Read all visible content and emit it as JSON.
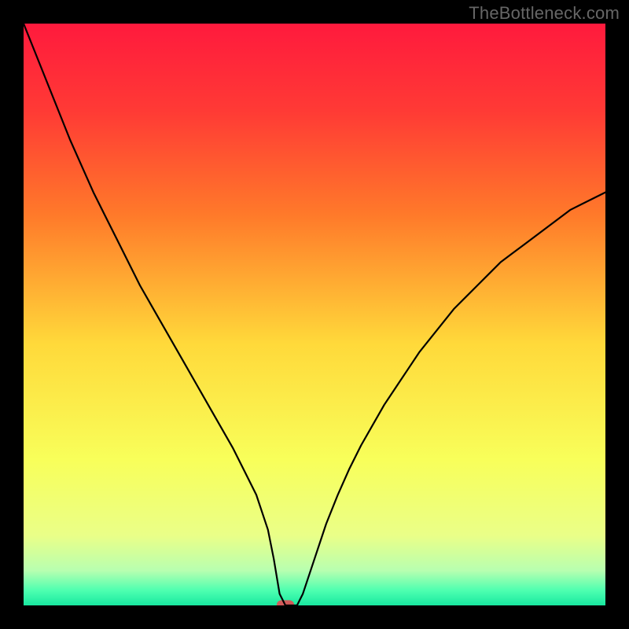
{
  "watermark": "TheBottleneck.com",
  "chart_data": {
    "type": "line",
    "title": "",
    "xlabel": "",
    "ylabel": "",
    "xlim": [
      0,
      100
    ],
    "ylim": [
      0,
      100
    ],
    "x": [
      0,
      2,
      4,
      6,
      8,
      10,
      12,
      14,
      16,
      18,
      20,
      22,
      24,
      26,
      28,
      30,
      32,
      34,
      36,
      38,
      40,
      42,
      43,
      44,
      45,
      46,
      47,
      48,
      50,
      52,
      54,
      56,
      58,
      60,
      62,
      64,
      66,
      68,
      70,
      72,
      74,
      76,
      78,
      80,
      82,
      84,
      86,
      88,
      90,
      92,
      94,
      96,
      98,
      100
    ],
    "values": [
      100,
      95,
      90,
      85,
      80,
      75.5,
      71,
      67,
      63,
      59,
      55,
      51.5,
      48,
      44.5,
      41,
      37.5,
      34,
      30.5,
      27,
      23,
      19,
      13,
      8,
      2,
      0,
      0,
      0,
      2,
      8,
      14,
      19,
      23.5,
      27.5,
      31,
      34.5,
      37.5,
      40.5,
      43.5,
      46,
      48.5,
      51,
      53,
      55,
      57,
      59,
      60.5,
      62,
      63.5,
      65,
      66.5,
      68,
      69,
      70,
      71
    ],
    "background_gradient": {
      "stops": [
        {
          "pos": 0.0,
          "color": "#ff1a3d"
        },
        {
          "pos": 0.15,
          "color": "#ff3a35"
        },
        {
          "pos": 0.33,
          "color": "#ff7a2a"
        },
        {
          "pos": 0.55,
          "color": "#ffd93a"
        },
        {
          "pos": 0.75,
          "color": "#f8ff5a"
        },
        {
          "pos": 0.88,
          "color": "#eaff88"
        },
        {
          "pos": 0.94,
          "color": "#b8ffb0"
        },
        {
          "pos": 0.975,
          "color": "#4cffb0"
        },
        {
          "pos": 1.0,
          "color": "#18e8a0"
        }
      ]
    },
    "marker": {
      "x": 45,
      "y": 0,
      "width_pct": 3,
      "color": "#d25a5a",
      "shape": "rounded-rect"
    },
    "line_color": "#000000",
    "line_width": 2.2
  }
}
